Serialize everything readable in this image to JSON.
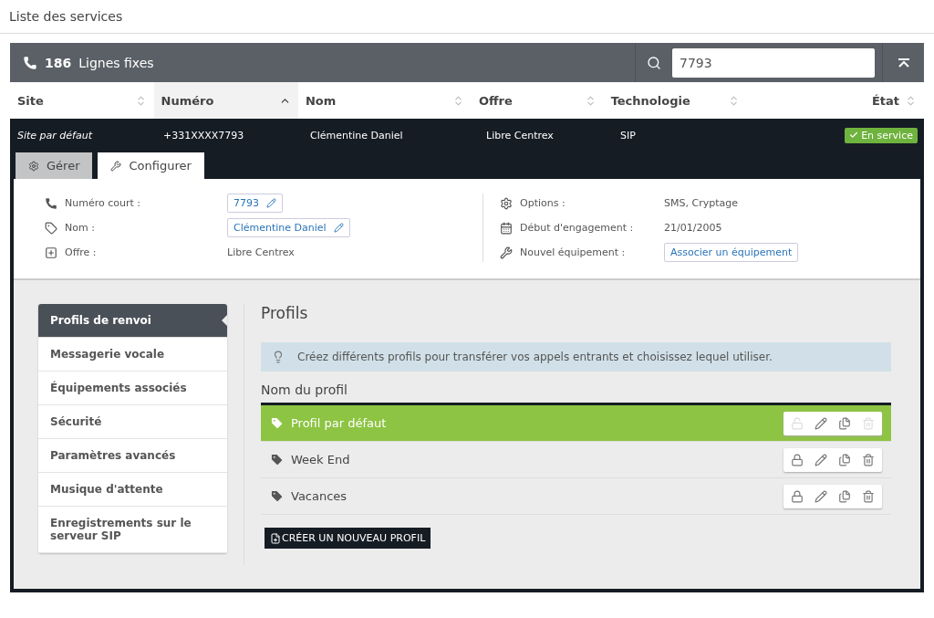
{
  "page_title": "Liste des services",
  "header": {
    "count": "186",
    "title": "Lignes fixes",
    "search": {
      "value": "7793"
    }
  },
  "table": {
    "columns": [
      {
        "label": "Site",
        "selected": false
      },
      {
        "label": "Numéro",
        "selected": true
      },
      {
        "label": "Nom",
        "selected": false
      },
      {
        "label": "Offre",
        "selected": false
      },
      {
        "label": "Technologie",
        "selected": false
      },
      {
        "label": "État",
        "selected": false
      }
    ],
    "row": {
      "site": "Site par défaut",
      "numero": "+331XXXX7793",
      "nom": "Clémentine Daniel",
      "offre": "Libre Centrex",
      "technologie": "SIP",
      "etat": "En service"
    }
  },
  "tabs": [
    {
      "label": "Gérer",
      "selected": false
    },
    {
      "label": "Configurer",
      "selected": true
    }
  ],
  "details_left": [
    {
      "label": "Numéro court :",
      "value": "7793",
      "kind": "editable"
    },
    {
      "label": "Nom :",
      "value": "Clémentine Daniel",
      "kind": "editable"
    },
    {
      "label": "Offre :",
      "value": "Libre Centrex",
      "kind": "text"
    }
  ],
  "details_right": [
    {
      "label": "Options :",
      "value": "SMS, Cryptage",
      "kind": "text"
    },
    {
      "label": "Début d'engagement :",
      "value": "21/01/2005",
      "kind": "text"
    },
    {
      "label": "Nouvel équipement :",
      "value": "Associer un équipement",
      "kind": "button"
    }
  ],
  "sidebar": {
    "items": [
      {
        "label": "Profils de renvoi",
        "selected": true
      },
      {
        "label": "Messagerie vocale",
        "selected": false
      },
      {
        "label": "Équipements associés",
        "selected": false
      },
      {
        "label": "Sécurité",
        "selected": false
      },
      {
        "label": "Paramètres avancés",
        "selected": false
      },
      {
        "label": "Musique d'attente",
        "selected": false
      },
      {
        "label": "Enregistrements sur le serveur SIP",
        "selected": false
      }
    ]
  },
  "content": {
    "title": "Profils",
    "info": "Créez différents profils pour transférer vos appels entrants et choisissez lequel utiliser.",
    "column": "Nom du profil",
    "profiles": [
      {
        "name": "Profil par défaut",
        "selected": true,
        "locked": false
      },
      {
        "name": "Week End",
        "selected": false,
        "locked": true
      },
      {
        "name": "Vacances",
        "selected": false,
        "locked": true
      }
    ],
    "create_button": "CRÉER UN NOUVEAU PROFIL"
  }
}
